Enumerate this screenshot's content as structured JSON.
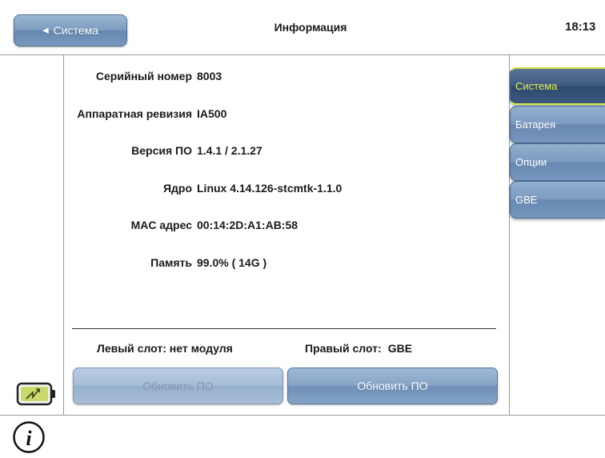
{
  "header": {
    "back_label": "Система",
    "title": "Информация",
    "time": "18:13"
  },
  "info": {
    "rows": [
      {
        "label": "Серийный номер",
        "value": "8003"
      },
      {
        "label": "Аппаратная ревизия",
        "value": "IA500"
      },
      {
        "label": "Версия ПО",
        "value": "1.4.1 / 2.1.27"
      },
      {
        "label": "Ядро",
        "value": "Linux 4.14.126-stcmtk-1.1.0"
      },
      {
        "label": "MAC адрес",
        "value": "00:14:2D:A1:AB:58"
      },
      {
        "label": "Память",
        "value": "99.0% ( 14G )"
      }
    ]
  },
  "slots": {
    "left_label": "Левый слот:",
    "left_value": "нет модуля",
    "right_label": "Правый слот:",
    "right_value": "GBE"
  },
  "buttons": {
    "update_left": "Обновить ПО",
    "update_right": "Обновить ПО"
  },
  "tabs": [
    {
      "label": "Система",
      "selected": true
    },
    {
      "label": "Батарея",
      "selected": false
    },
    {
      "label": "Опции",
      "selected": false
    },
    {
      "label": "GBE",
      "selected": false
    }
  ],
  "icons": {
    "battery": "battery-charging-icon",
    "info": "info-icon"
  },
  "colors": {
    "button_blue": "#7d9cc0",
    "tab_selected": "#3f5b80",
    "tab_selected_text": "#e9ef4a"
  }
}
